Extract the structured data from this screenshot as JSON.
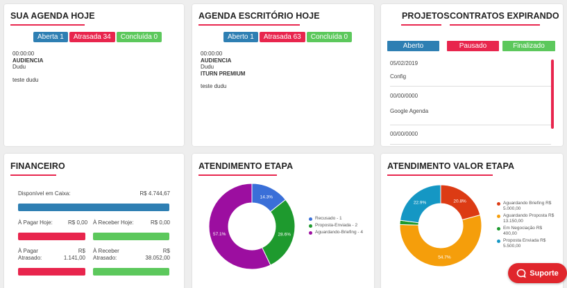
{
  "agenda": {
    "title": "SUA AGENDA HOJE",
    "badges": {
      "open": "Aberta 1",
      "late": "Atrasada 34",
      "done": "Concluída 0"
    },
    "entry": {
      "time": "00:00:00",
      "type": "AUDIENCIA",
      "person": "Dudu",
      "note": "teste dudu"
    }
  },
  "office": {
    "title": "AGENDA ESCRITÓRIO HOJE",
    "badges": {
      "open": "Aberto 1",
      "late": "Atrasada 63",
      "done": "Concluída 0"
    },
    "entry": {
      "time": "00:00:00",
      "type": "AUDIENCIA",
      "person": "Dudu",
      "client": "ITURN PREMIUM",
      "note": "teste dudu"
    }
  },
  "projects": {
    "tab_projects": "PROJETOS",
    "tab_contracts": "CONTRATOS EXPIRANDO",
    "buttons": {
      "open": "Aberto",
      "paused": "Pausado",
      "finished": "Finalizado"
    },
    "items": [
      {
        "date": "05/02/2019",
        "name": "Config"
      },
      {
        "date": "00/00/0000",
        "name": "Google Agenda"
      },
      {
        "date": "00/00/0000",
        "name": ""
      }
    ]
  },
  "finance": {
    "title": "FINANCEIRO",
    "available_label": "Disponível em Caixa:",
    "available_value": "R$ 4.744,67",
    "pay_today_label": "À Pagar Hoje:",
    "pay_today_value": "R$ 0,00",
    "receive_today_label": "À Receber Hoje:",
    "receive_today_value": "R$ 0,00",
    "pay_late_label1": "À Pagar",
    "pay_late_label2": "Atrasado:",
    "pay_late_currency": "R$",
    "pay_late_value": "1.141,00",
    "receive_late_label1": "À Receber",
    "receive_late_label2": "Atrasado:",
    "receive_late_currency": "R$",
    "receive_late_value": "38.052,00"
  },
  "stage": {
    "title": "ATENDIMENTO ETAPA",
    "chart_data": {
      "type": "pie",
      "slices": [
        {
          "label": "Recusado - 1",
          "value": 14.3,
          "color": "#3a6fd8",
          "text": "14.3%"
        },
        {
          "label": "Proposta-Enviada - 2",
          "value": 28.6,
          "color": "#1e9a2e",
          "text": "28.6%"
        },
        {
          "label": "Aguardando-Briefing - 4",
          "value": 57.1,
          "color": "#9c0ea0",
          "text": "57.1%"
        }
      ]
    }
  },
  "stage_value": {
    "title": "ATENDIMENTO VALOR ETAPA",
    "chart_data": {
      "type": "pie",
      "slices": [
        {
          "label": "Aguardando Briefing R$ 5.000,00",
          "value": 20.8,
          "color": "#dc3b14",
          "text": "20.8%"
        },
        {
          "label": "Aguardando Proposta R$ 13.150,00",
          "value": 54.7,
          "color": "#f59e0b",
          "text": "54.7%"
        },
        {
          "label": "Em Negociação R$ 400,00",
          "value": 1.7,
          "color": "#1e9a2e",
          "text": ""
        },
        {
          "label": "Proposta Enviada R$ 5.500,00",
          "value": 22.9,
          "color": "#1597c4",
          "text": "22.9%"
        }
      ]
    }
  },
  "support": {
    "label": "Suporte"
  }
}
